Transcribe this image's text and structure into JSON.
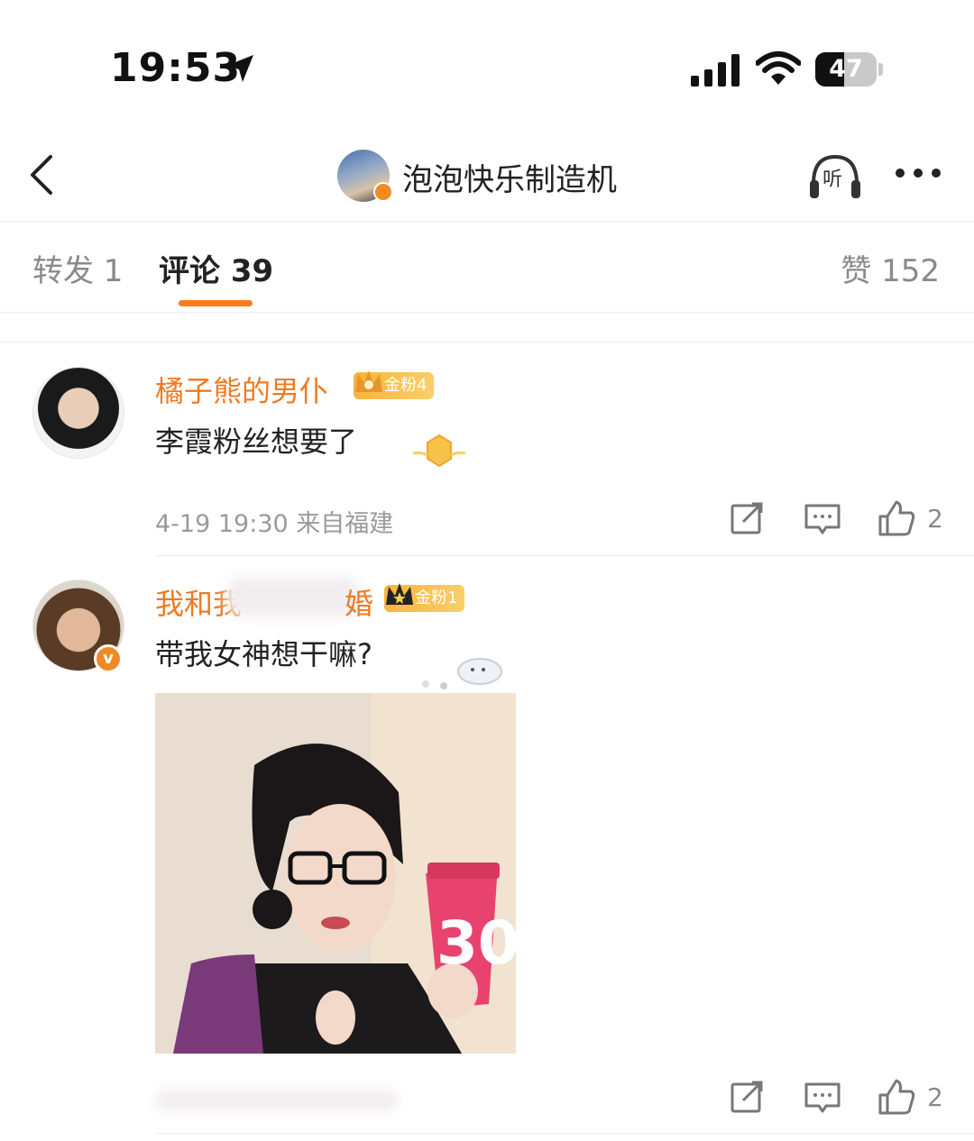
{
  "status_bar": {
    "time": "19:53",
    "battery": "47",
    "battery_level": 0.47
  },
  "nav": {
    "title": "泡泡快乐制造机",
    "listen_label": "听"
  },
  "tabs": {
    "forward": "转发 1",
    "comment": "评论 39",
    "like": "赞 152"
  },
  "comments": [
    {
      "username": "橘子熊的男仆",
      "fan_badge": "金粉4",
      "text": "李霞粉丝想要了",
      "meta": "4-19 19:30 来自福建",
      "likes": "2"
    },
    {
      "username": "我和我",
      "username_tail": "婚",
      "fan_badge": "金粉1",
      "text": "带我女神想干嘛?",
      "image_caption": "30",
      "likes": "2"
    }
  ],
  "colors": {
    "accent": "#ff7a1a",
    "username": "#ef7a22",
    "badge": "#f7b43a"
  },
  "icons": [
    "location-arrow-icon",
    "signal-icon",
    "wifi-icon",
    "battery-icon",
    "back-icon",
    "headphones-icon",
    "more-icon",
    "repost-icon",
    "comment-icon",
    "thumbs-up-icon",
    "crown-icon"
  ]
}
